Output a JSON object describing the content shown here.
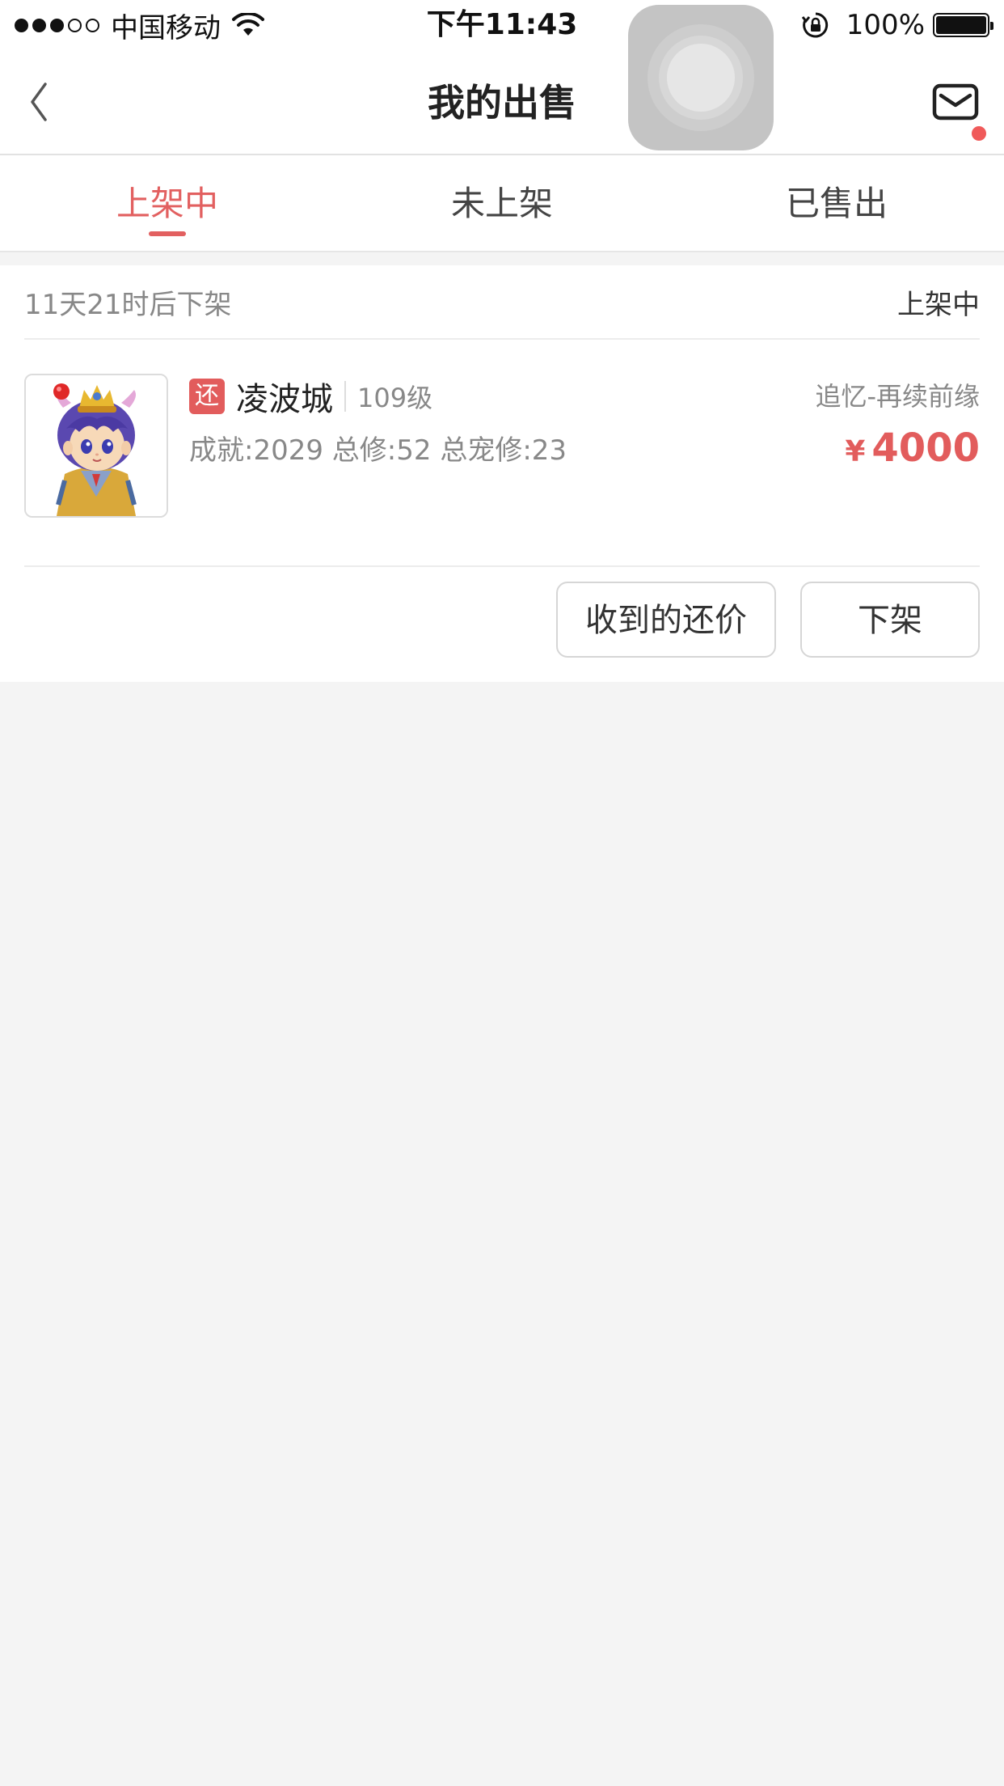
{
  "status_bar": {
    "carrier": "中国移动",
    "time": "下午11:43",
    "battery_percent": "100%",
    "signal_strength": 3,
    "icons": [
      "signal-dots-icon",
      "wifi-icon",
      "rotation-lock-icon",
      "battery-icon"
    ]
  },
  "nav": {
    "title": "我的出售",
    "back_icon": "chevron-left-icon",
    "mail_icon": "mail-icon"
  },
  "tabs": [
    {
      "label": "上架中",
      "active": true
    },
    {
      "label": "未上架",
      "active": false
    },
    {
      "label": "已售出",
      "active": false
    }
  ],
  "listing": {
    "countdown": "11天21时后下架",
    "status": "上架中",
    "badge": "还",
    "server_name": "凌波城",
    "level": "109级",
    "stats": "成就:2029 总修:52 总宠修:23",
    "region": "追忆-再续前缘",
    "currency": "¥",
    "price": "4000",
    "buttons": {
      "offers": "收到的还价",
      "delist": "下架"
    }
  },
  "colors": {
    "accent": "#e26060",
    "price": "#e25c5c",
    "background": "#f4f4f4"
  }
}
